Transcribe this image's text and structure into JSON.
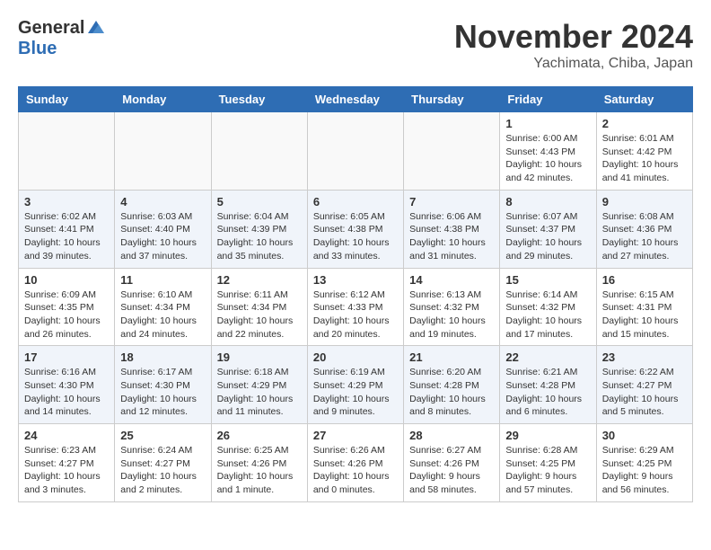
{
  "logo": {
    "general": "General",
    "blue": "Blue"
  },
  "title": "November 2024",
  "location": "Yachimata, Chiba, Japan",
  "days_of_week": [
    "Sunday",
    "Monday",
    "Tuesday",
    "Wednesday",
    "Thursday",
    "Friday",
    "Saturday"
  ],
  "weeks": [
    [
      {
        "day": "",
        "info": ""
      },
      {
        "day": "",
        "info": ""
      },
      {
        "day": "",
        "info": ""
      },
      {
        "day": "",
        "info": ""
      },
      {
        "day": "",
        "info": ""
      },
      {
        "day": "1",
        "info": "Sunrise: 6:00 AM\nSunset: 4:43 PM\nDaylight: 10 hours\nand 42 minutes."
      },
      {
        "day": "2",
        "info": "Sunrise: 6:01 AM\nSunset: 4:42 PM\nDaylight: 10 hours\nand 41 minutes."
      }
    ],
    [
      {
        "day": "3",
        "info": "Sunrise: 6:02 AM\nSunset: 4:41 PM\nDaylight: 10 hours\nand 39 minutes."
      },
      {
        "day": "4",
        "info": "Sunrise: 6:03 AM\nSunset: 4:40 PM\nDaylight: 10 hours\nand 37 minutes."
      },
      {
        "day": "5",
        "info": "Sunrise: 6:04 AM\nSunset: 4:39 PM\nDaylight: 10 hours\nand 35 minutes."
      },
      {
        "day": "6",
        "info": "Sunrise: 6:05 AM\nSunset: 4:38 PM\nDaylight: 10 hours\nand 33 minutes."
      },
      {
        "day": "7",
        "info": "Sunrise: 6:06 AM\nSunset: 4:38 PM\nDaylight: 10 hours\nand 31 minutes."
      },
      {
        "day": "8",
        "info": "Sunrise: 6:07 AM\nSunset: 4:37 PM\nDaylight: 10 hours\nand 29 minutes."
      },
      {
        "day": "9",
        "info": "Sunrise: 6:08 AM\nSunset: 4:36 PM\nDaylight: 10 hours\nand 27 minutes."
      }
    ],
    [
      {
        "day": "10",
        "info": "Sunrise: 6:09 AM\nSunset: 4:35 PM\nDaylight: 10 hours\nand 26 minutes."
      },
      {
        "day": "11",
        "info": "Sunrise: 6:10 AM\nSunset: 4:34 PM\nDaylight: 10 hours\nand 24 minutes."
      },
      {
        "day": "12",
        "info": "Sunrise: 6:11 AM\nSunset: 4:34 PM\nDaylight: 10 hours\nand 22 minutes."
      },
      {
        "day": "13",
        "info": "Sunrise: 6:12 AM\nSunset: 4:33 PM\nDaylight: 10 hours\nand 20 minutes."
      },
      {
        "day": "14",
        "info": "Sunrise: 6:13 AM\nSunset: 4:32 PM\nDaylight: 10 hours\nand 19 minutes."
      },
      {
        "day": "15",
        "info": "Sunrise: 6:14 AM\nSunset: 4:32 PM\nDaylight: 10 hours\nand 17 minutes."
      },
      {
        "day": "16",
        "info": "Sunrise: 6:15 AM\nSunset: 4:31 PM\nDaylight: 10 hours\nand 15 minutes."
      }
    ],
    [
      {
        "day": "17",
        "info": "Sunrise: 6:16 AM\nSunset: 4:30 PM\nDaylight: 10 hours\nand 14 minutes."
      },
      {
        "day": "18",
        "info": "Sunrise: 6:17 AM\nSunset: 4:30 PM\nDaylight: 10 hours\nand 12 minutes."
      },
      {
        "day": "19",
        "info": "Sunrise: 6:18 AM\nSunset: 4:29 PM\nDaylight: 10 hours\nand 11 minutes."
      },
      {
        "day": "20",
        "info": "Sunrise: 6:19 AM\nSunset: 4:29 PM\nDaylight: 10 hours\nand 9 minutes."
      },
      {
        "day": "21",
        "info": "Sunrise: 6:20 AM\nSunset: 4:28 PM\nDaylight: 10 hours\nand 8 minutes."
      },
      {
        "day": "22",
        "info": "Sunrise: 6:21 AM\nSunset: 4:28 PM\nDaylight: 10 hours\nand 6 minutes."
      },
      {
        "day": "23",
        "info": "Sunrise: 6:22 AM\nSunset: 4:27 PM\nDaylight: 10 hours\nand 5 minutes."
      }
    ],
    [
      {
        "day": "24",
        "info": "Sunrise: 6:23 AM\nSunset: 4:27 PM\nDaylight: 10 hours\nand 3 minutes."
      },
      {
        "day": "25",
        "info": "Sunrise: 6:24 AM\nSunset: 4:27 PM\nDaylight: 10 hours\nand 2 minutes."
      },
      {
        "day": "26",
        "info": "Sunrise: 6:25 AM\nSunset: 4:26 PM\nDaylight: 10 hours\nand 1 minute."
      },
      {
        "day": "27",
        "info": "Sunrise: 6:26 AM\nSunset: 4:26 PM\nDaylight: 10 hours\nand 0 minutes."
      },
      {
        "day": "28",
        "info": "Sunrise: 6:27 AM\nSunset: 4:26 PM\nDaylight: 9 hours\nand 58 minutes."
      },
      {
        "day": "29",
        "info": "Sunrise: 6:28 AM\nSunset: 4:25 PM\nDaylight: 9 hours\nand 57 minutes."
      },
      {
        "day": "30",
        "info": "Sunrise: 6:29 AM\nSunset: 4:25 PM\nDaylight: 9 hours\nand 56 minutes."
      }
    ]
  ]
}
